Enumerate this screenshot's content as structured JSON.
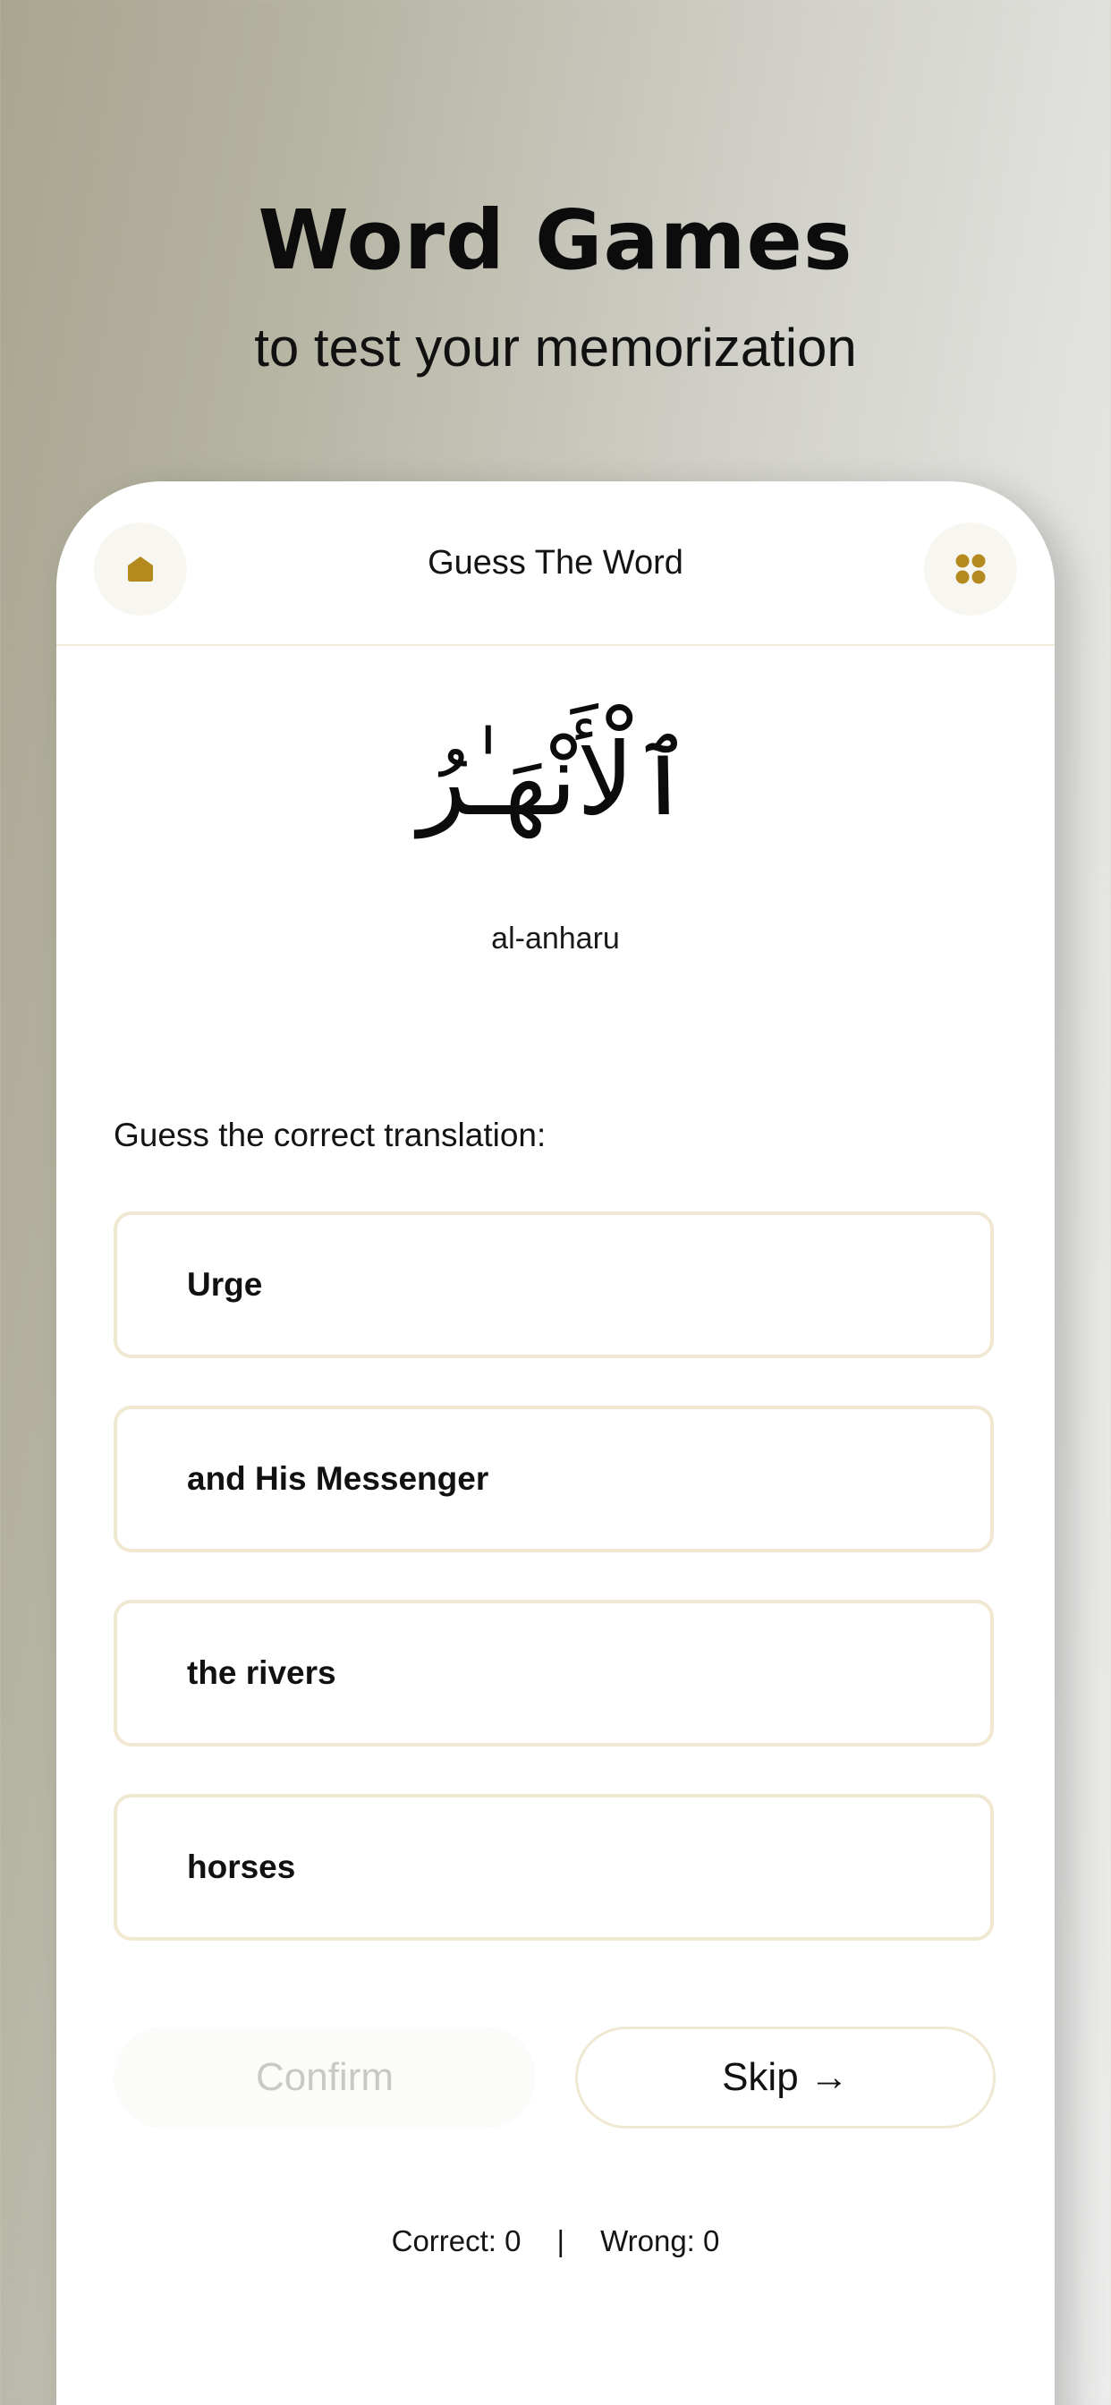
{
  "hero": {
    "title": "Word Games",
    "subtitle": "to test your memorization"
  },
  "header": {
    "title": "Guess The Word",
    "home_icon": "home-icon",
    "menu_icon": "grid-icon",
    "accent_color": "#b48a1e"
  },
  "word": {
    "arabic": "ٱلْأَنْهَـٰرُ",
    "transliteration": "al-anharu"
  },
  "quiz": {
    "prompt": "Guess the correct translation:",
    "options": [
      {
        "label": "Urge"
      },
      {
        "label": "and His Messenger"
      },
      {
        "label": "the rivers"
      },
      {
        "label": "horses"
      }
    ]
  },
  "actions": {
    "confirm_label": "Confirm",
    "skip_label": "Skip →"
  },
  "score": {
    "correct_label": "Correct: 0",
    "separator": "|",
    "wrong_label": "Wrong: 0"
  }
}
